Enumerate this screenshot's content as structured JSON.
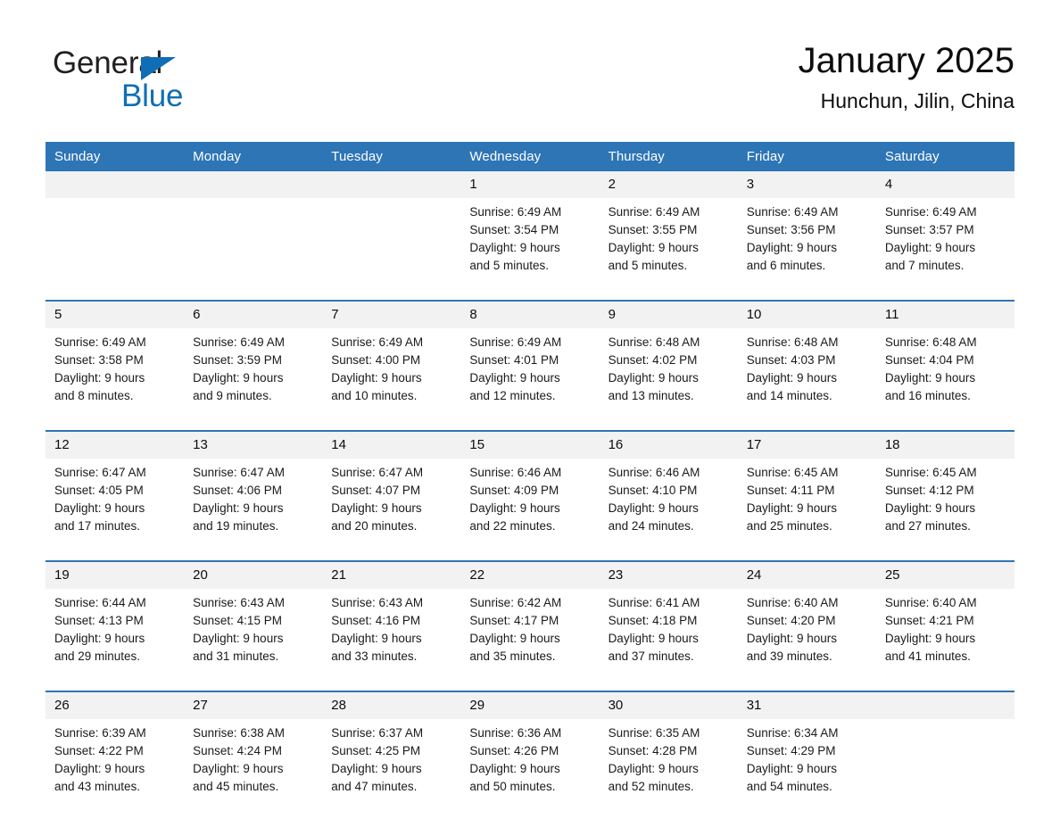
{
  "brand": {
    "name_part1": "General",
    "name_part2": "Blue",
    "accent_color": "#0f6eb5"
  },
  "header": {
    "month_title": "January 2025",
    "location": "Hunchun, Jilin, China"
  },
  "theme": {
    "header_blue": "#2e75b6",
    "daynum_gray": "#f2f2f2"
  },
  "weekday_headers": [
    "Sunday",
    "Monday",
    "Tuesday",
    "Wednesday",
    "Thursday",
    "Friday",
    "Saturday"
  ],
  "weeks": [
    [
      {
        "day": "",
        "lines": [
          "",
          "",
          "",
          ""
        ]
      },
      {
        "day": "",
        "lines": [
          "",
          "",
          "",
          ""
        ]
      },
      {
        "day": "",
        "lines": [
          "",
          "",
          "",
          ""
        ]
      },
      {
        "day": "1",
        "lines": [
          "Sunrise: 6:49 AM",
          "Sunset: 3:54 PM",
          "Daylight: 9 hours",
          "and 5 minutes."
        ]
      },
      {
        "day": "2",
        "lines": [
          "Sunrise: 6:49 AM",
          "Sunset: 3:55 PM",
          "Daylight: 9 hours",
          "and 5 minutes."
        ]
      },
      {
        "day": "3",
        "lines": [
          "Sunrise: 6:49 AM",
          "Sunset: 3:56 PM",
          "Daylight: 9 hours",
          "and 6 minutes."
        ]
      },
      {
        "day": "4",
        "lines": [
          "Sunrise: 6:49 AM",
          "Sunset: 3:57 PM",
          "Daylight: 9 hours",
          "and 7 minutes."
        ]
      }
    ],
    [
      {
        "day": "5",
        "lines": [
          "Sunrise: 6:49 AM",
          "Sunset: 3:58 PM",
          "Daylight: 9 hours",
          "and 8 minutes."
        ]
      },
      {
        "day": "6",
        "lines": [
          "Sunrise: 6:49 AM",
          "Sunset: 3:59 PM",
          "Daylight: 9 hours",
          "and 9 minutes."
        ]
      },
      {
        "day": "7",
        "lines": [
          "Sunrise: 6:49 AM",
          "Sunset: 4:00 PM",
          "Daylight: 9 hours",
          "and 10 minutes."
        ]
      },
      {
        "day": "8",
        "lines": [
          "Sunrise: 6:49 AM",
          "Sunset: 4:01 PM",
          "Daylight: 9 hours",
          "and 12 minutes."
        ]
      },
      {
        "day": "9",
        "lines": [
          "Sunrise: 6:48 AM",
          "Sunset: 4:02 PM",
          "Daylight: 9 hours",
          "and 13 minutes."
        ]
      },
      {
        "day": "10",
        "lines": [
          "Sunrise: 6:48 AM",
          "Sunset: 4:03 PM",
          "Daylight: 9 hours",
          "and 14 minutes."
        ]
      },
      {
        "day": "11",
        "lines": [
          "Sunrise: 6:48 AM",
          "Sunset: 4:04 PM",
          "Daylight: 9 hours",
          "and 16 minutes."
        ]
      }
    ],
    [
      {
        "day": "12",
        "lines": [
          "Sunrise: 6:47 AM",
          "Sunset: 4:05 PM",
          "Daylight: 9 hours",
          "and 17 minutes."
        ]
      },
      {
        "day": "13",
        "lines": [
          "Sunrise: 6:47 AM",
          "Sunset: 4:06 PM",
          "Daylight: 9 hours",
          "and 19 minutes."
        ]
      },
      {
        "day": "14",
        "lines": [
          "Sunrise: 6:47 AM",
          "Sunset: 4:07 PM",
          "Daylight: 9 hours",
          "and 20 minutes."
        ]
      },
      {
        "day": "15",
        "lines": [
          "Sunrise: 6:46 AM",
          "Sunset: 4:09 PM",
          "Daylight: 9 hours",
          "and 22 minutes."
        ]
      },
      {
        "day": "16",
        "lines": [
          "Sunrise: 6:46 AM",
          "Sunset: 4:10 PM",
          "Daylight: 9 hours",
          "and 24 minutes."
        ]
      },
      {
        "day": "17",
        "lines": [
          "Sunrise: 6:45 AM",
          "Sunset: 4:11 PM",
          "Daylight: 9 hours",
          "and 25 minutes."
        ]
      },
      {
        "day": "18",
        "lines": [
          "Sunrise: 6:45 AM",
          "Sunset: 4:12 PM",
          "Daylight: 9 hours",
          "and 27 minutes."
        ]
      }
    ],
    [
      {
        "day": "19",
        "lines": [
          "Sunrise: 6:44 AM",
          "Sunset: 4:13 PM",
          "Daylight: 9 hours",
          "and 29 minutes."
        ]
      },
      {
        "day": "20",
        "lines": [
          "Sunrise: 6:43 AM",
          "Sunset: 4:15 PM",
          "Daylight: 9 hours",
          "and 31 minutes."
        ]
      },
      {
        "day": "21",
        "lines": [
          "Sunrise: 6:43 AM",
          "Sunset: 4:16 PM",
          "Daylight: 9 hours",
          "and 33 minutes."
        ]
      },
      {
        "day": "22",
        "lines": [
          "Sunrise: 6:42 AM",
          "Sunset: 4:17 PM",
          "Daylight: 9 hours",
          "and 35 minutes."
        ]
      },
      {
        "day": "23",
        "lines": [
          "Sunrise: 6:41 AM",
          "Sunset: 4:18 PM",
          "Daylight: 9 hours",
          "and 37 minutes."
        ]
      },
      {
        "day": "24",
        "lines": [
          "Sunrise: 6:40 AM",
          "Sunset: 4:20 PM",
          "Daylight: 9 hours",
          "and 39 minutes."
        ]
      },
      {
        "day": "25",
        "lines": [
          "Sunrise: 6:40 AM",
          "Sunset: 4:21 PM",
          "Daylight: 9 hours",
          "and 41 minutes."
        ]
      }
    ],
    [
      {
        "day": "26",
        "lines": [
          "Sunrise: 6:39 AM",
          "Sunset: 4:22 PM",
          "Daylight: 9 hours",
          "and 43 minutes."
        ]
      },
      {
        "day": "27",
        "lines": [
          "Sunrise: 6:38 AM",
          "Sunset: 4:24 PM",
          "Daylight: 9 hours",
          "and 45 minutes."
        ]
      },
      {
        "day": "28",
        "lines": [
          "Sunrise: 6:37 AM",
          "Sunset: 4:25 PM",
          "Daylight: 9 hours",
          "and 47 minutes."
        ]
      },
      {
        "day": "29",
        "lines": [
          "Sunrise: 6:36 AM",
          "Sunset: 4:26 PM",
          "Daylight: 9 hours",
          "and 50 minutes."
        ]
      },
      {
        "day": "30",
        "lines": [
          "Sunrise: 6:35 AM",
          "Sunset: 4:28 PM",
          "Daylight: 9 hours",
          "and 52 minutes."
        ]
      },
      {
        "day": "31",
        "lines": [
          "Sunrise: 6:34 AM",
          "Sunset: 4:29 PM",
          "Daylight: 9 hours",
          "and 54 minutes."
        ]
      },
      {
        "day": "",
        "lines": [
          "",
          "",
          "",
          ""
        ]
      }
    ]
  ]
}
